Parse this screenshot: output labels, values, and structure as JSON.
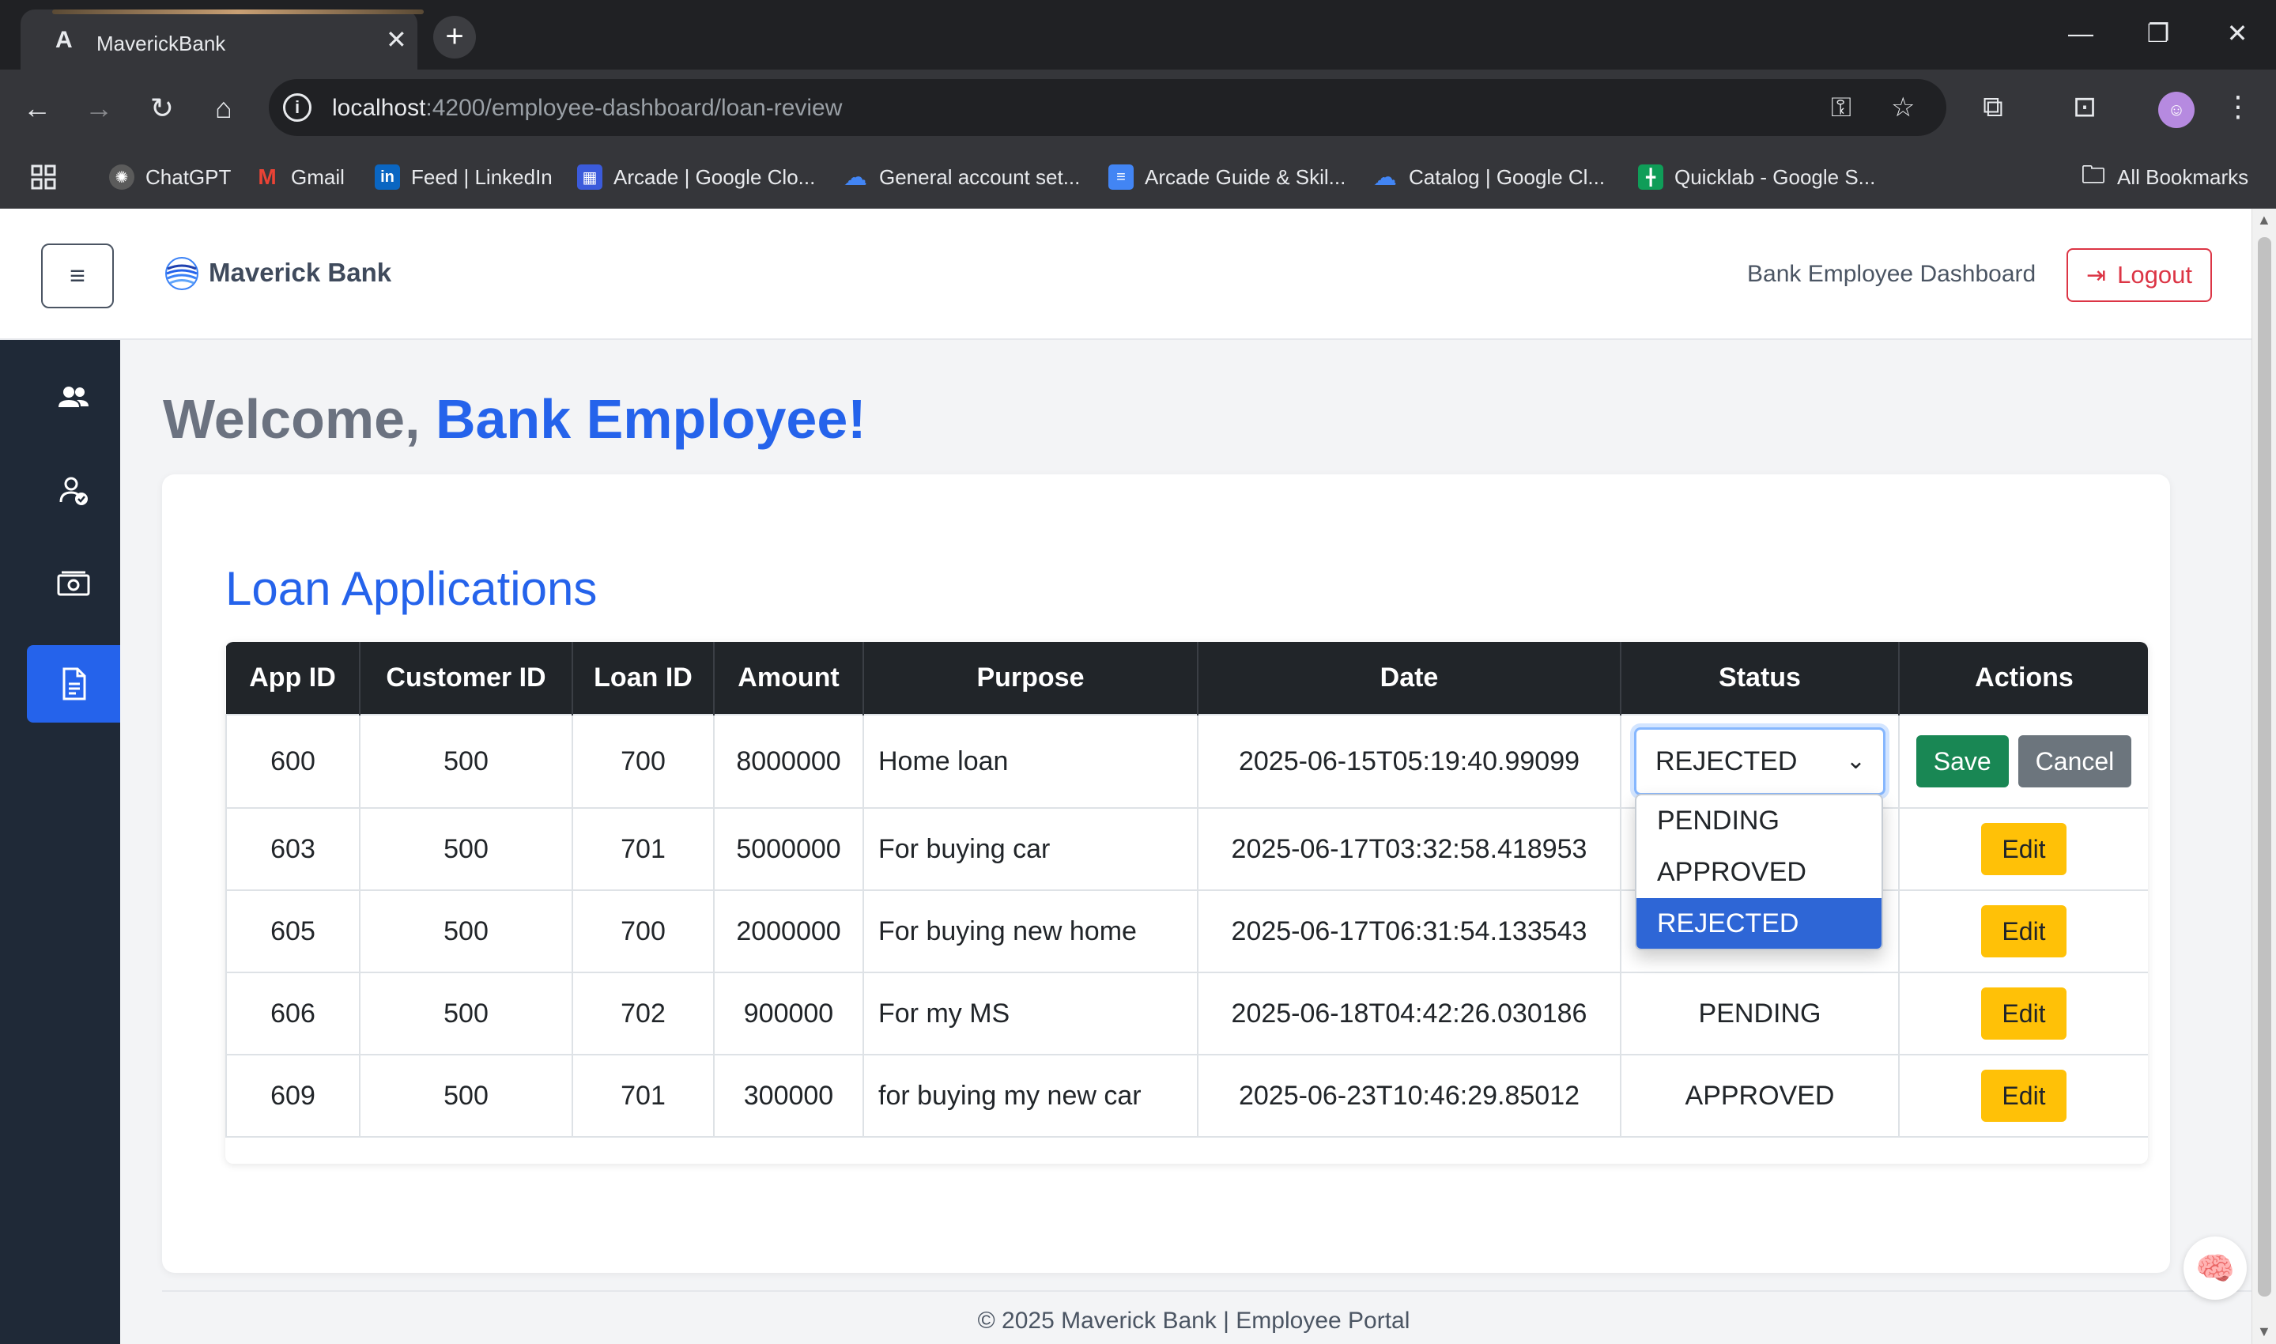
{
  "browser": {
    "tab_title": "MaverickBank",
    "tab_favicon": "A",
    "new_tab_symbol": "+",
    "url_host": "localhost",
    "url_path": ":4200/employee-dashboard/loan-review",
    "window": {
      "minimize": "—",
      "restore": "❐",
      "close": "✕"
    },
    "bookmarks": [
      {
        "label": "ChatGPT",
        "icon": "chatgpt-icon",
        "color": "#444444"
      },
      {
        "label": "Gmail",
        "icon": "gmail-icon",
        "color": "#ea4335"
      },
      {
        "label": "Feed | LinkedIn",
        "icon": "linkedin-icon",
        "color": "#0a66c2"
      },
      {
        "label": "Arcade | Google Clo...",
        "icon": "arcade-icon",
        "color": "#3b5bdb"
      },
      {
        "label": "General account set...",
        "icon": "google-cloud-icon",
        "color": "#4285f4"
      },
      {
        "label": "Arcade Guide & Skil...",
        "icon": "docs-icon",
        "color": "#4285f4"
      },
      {
        "label": "Catalog | Google Cl...",
        "icon": "google-cloud-icon",
        "color": "#4285f4"
      },
      {
        "label": "Quicklab - Google S...",
        "icon": "sheets-icon",
        "color": "#0f9d58"
      }
    ],
    "all_bookmarks": "All Bookmarks"
  },
  "header": {
    "brand": "Maverick Bank",
    "title": "Bank Employee Dashboard",
    "logout": "Logout",
    "menu_symbol": "≡"
  },
  "welcome": {
    "prefix": "Welcome, ",
    "name": "Bank Employee!"
  },
  "loans": {
    "title": "Loan Applications",
    "columns": [
      "App ID",
      "Customer ID",
      "Loan ID",
      "Amount",
      "Purpose",
      "Date",
      "Status",
      "Actions"
    ],
    "rows": [
      {
        "app_id": "600",
        "customer_id": "500",
        "loan_id": "700",
        "amount": "8000000",
        "purpose": "Home loan",
        "date": "2025-06-15T05:19:40.99099",
        "status": "REJECTED"
      },
      {
        "app_id": "603",
        "customer_id": "500",
        "loan_id": "701",
        "amount": "5000000",
        "purpose": "For buying car",
        "date": "2025-06-17T03:32:58.418953",
        "status": ""
      },
      {
        "app_id": "605",
        "customer_id": "500",
        "loan_id": "700",
        "amount": "2000000",
        "purpose": "For buying new home",
        "date": "2025-06-17T06:31:54.133543",
        "status": ""
      },
      {
        "app_id": "606",
        "customer_id": "500",
        "loan_id": "702",
        "amount": "900000",
        "purpose": "For my MS",
        "date": "2025-06-18T04:42:26.030186",
        "status": "PENDING"
      },
      {
        "app_id": "609",
        "customer_id": "500",
        "loan_id": "701",
        "amount": "300000",
        "purpose": "for buying my new car",
        "date": "2025-06-23T10:46:29.85012",
        "status": "APPROVED"
      }
    ],
    "editing": {
      "selected": "REJECTED",
      "options": [
        "PENDING",
        "APPROVED",
        "REJECTED"
      ],
      "save": "Save",
      "cancel": "Cancel"
    },
    "edit_label": "Edit"
  },
  "footer": {
    "text": "© 2025 Maverick Bank | Employee Portal"
  },
  "colors": {
    "accent": "#2563eb",
    "sidebar": "#1f2937",
    "save": "#198754",
    "edit": "#ffc107",
    "danger": "#dc3545"
  }
}
